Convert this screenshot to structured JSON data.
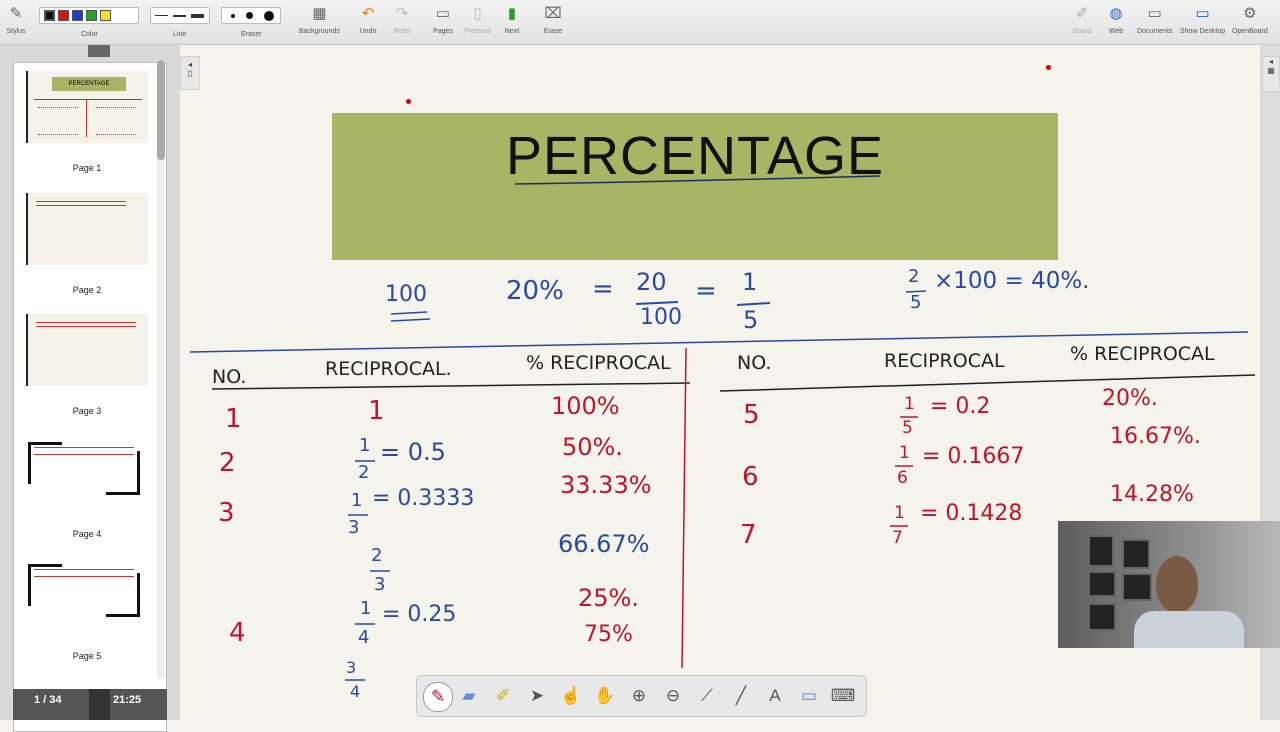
{
  "toolbar": {
    "stylus": "Stylus",
    "color": "Color",
    "line": "Line",
    "eraser": "Eraser",
    "backgrounds": "Backgrounds",
    "undo": "Undo",
    "redo": "Redo",
    "pages": "Pages",
    "previous": "Previous",
    "next": "Next",
    "erase": "Erase",
    "board": "Board",
    "web": "Web",
    "documents": "Documents",
    "show_desktop": "Show Desktop",
    "openboard": "OpenBoard",
    "colors": [
      "#111111",
      "#e01010",
      "#1a3fd0",
      "#22a322",
      "#f0e020"
    ]
  },
  "sidebar": {
    "pages": [
      "Page 1",
      "Page 2",
      "Page 3",
      "Page 4",
      "Page 5"
    ],
    "page1_title": "PERCENTAGE",
    "page_count": "1 / 34",
    "time": "21:25"
  },
  "board": {
    "title": "PERCENTAGE",
    "top_left": "100",
    "eq_20": "20%",
    "eq_eq1": "=",
    "eq_20n": "20",
    "eq_100d": "100",
    "eq_eq2": "=",
    "eq_1n": "1",
    "eq_5d": "5",
    "rhs_2": "2",
    "rhs_5": "5",
    "rhs_expr": "×100 = 40%.",
    "left_headers": [
      "NO.",
      "RECIPROCAL.",
      "% RECIPROCAL"
    ],
    "right_headers": [
      "NO.",
      "RECIPROCAL",
      "% RECIPROCAL"
    ],
    "left_no": [
      "1",
      "2",
      "3",
      "4"
    ],
    "left_recip_top": "1",
    "left_recip_half_n": "1",
    "left_recip_half_d": "2",
    "left_recip_half_v": "= 0.5",
    "left_recip_third_n": "1",
    "left_recip_third_d": "3",
    "left_recip_third_v": "= 0.3333",
    "left_recip_23_n": "2",
    "left_recip_23_d": "3",
    "left_recip_q_n": "1",
    "left_recip_q_d": "4",
    "left_recip_q_v": "= 0.25",
    "left_recip_34_n": "3",
    "left_recip_34_d": "4",
    "left_pct": [
      "100%",
      "50%.",
      "33.33%",
      "66.67%",
      "25%.",
      "75%"
    ],
    "right_no": [
      "5",
      "6",
      "7"
    ],
    "right_r1_n": "1",
    "right_r1_d": "5",
    "right_r1_v": "= 0.2",
    "right_r2_n": "1",
    "right_r2_d": "6",
    "right_r2_v": "= 0.1667",
    "right_r3_n": "1",
    "right_r3_d": "7",
    "right_r3_v": "= 0.1428",
    "right_pct": [
      "20%.",
      "16.67%.",
      "14.28%"
    ]
  },
  "palette": {
    "tools": [
      "pen-icon",
      "eraser-icon",
      "highlighter-icon",
      "pointer-icon",
      "laser-icon",
      "hand-icon",
      "zoom-in-icon",
      "zoom-out-icon",
      "capture-icon",
      "line-icon",
      "text-icon",
      "select-area-icon",
      "keyboard-icon"
    ]
  }
}
